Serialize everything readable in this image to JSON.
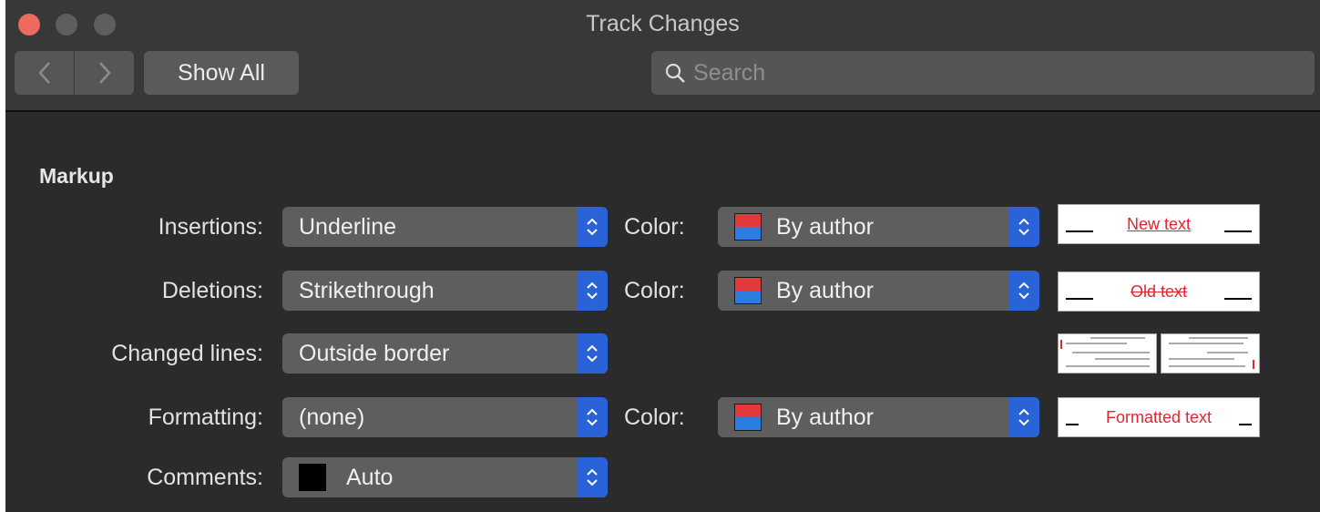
{
  "window": {
    "title": "Track Changes",
    "accent": "#2a62d8"
  },
  "toolbar": {
    "back_icon": "chevron-left-icon",
    "forward_icon": "chevron-right-icon",
    "show_all_label": "Show All",
    "search_placeholder": "Search",
    "search_value": ""
  },
  "markup": {
    "section_title": "Markup",
    "rows": {
      "insertions": {
        "label": "Insertions:",
        "value": "Underline",
        "color_label": "Color:",
        "color_value": "By author",
        "preview_text": "New text",
        "preview_color": "#e0262e"
      },
      "deletions": {
        "label": "Deletions:",
        "value": "Strikethrough",
        "color_label": "Color:",
        "color_value": "By author",
        "preview_text": "Old text",
        "preview_color": "#e0262e"
      },
      "changed_lines": {
        "label": "Changed lines:",
        "value": "Outside border"
      },
      "formatting": {
        "label": "Formatting:",
        "value": "(none)",
        "color_label": "Color:",
        "color_value": "By author",
        "preview_text": "Formatted text",
        "preview_color": "#e0262e"
      },
      "comments": {
        "label": "Comments:",
        "value": "Auto"
      }
    },
    "swatch_colors": {
      "top": "#e23a3a",
      "bottom": "#2b7de0",
      "auto": "#000000"
    }
  }
}
